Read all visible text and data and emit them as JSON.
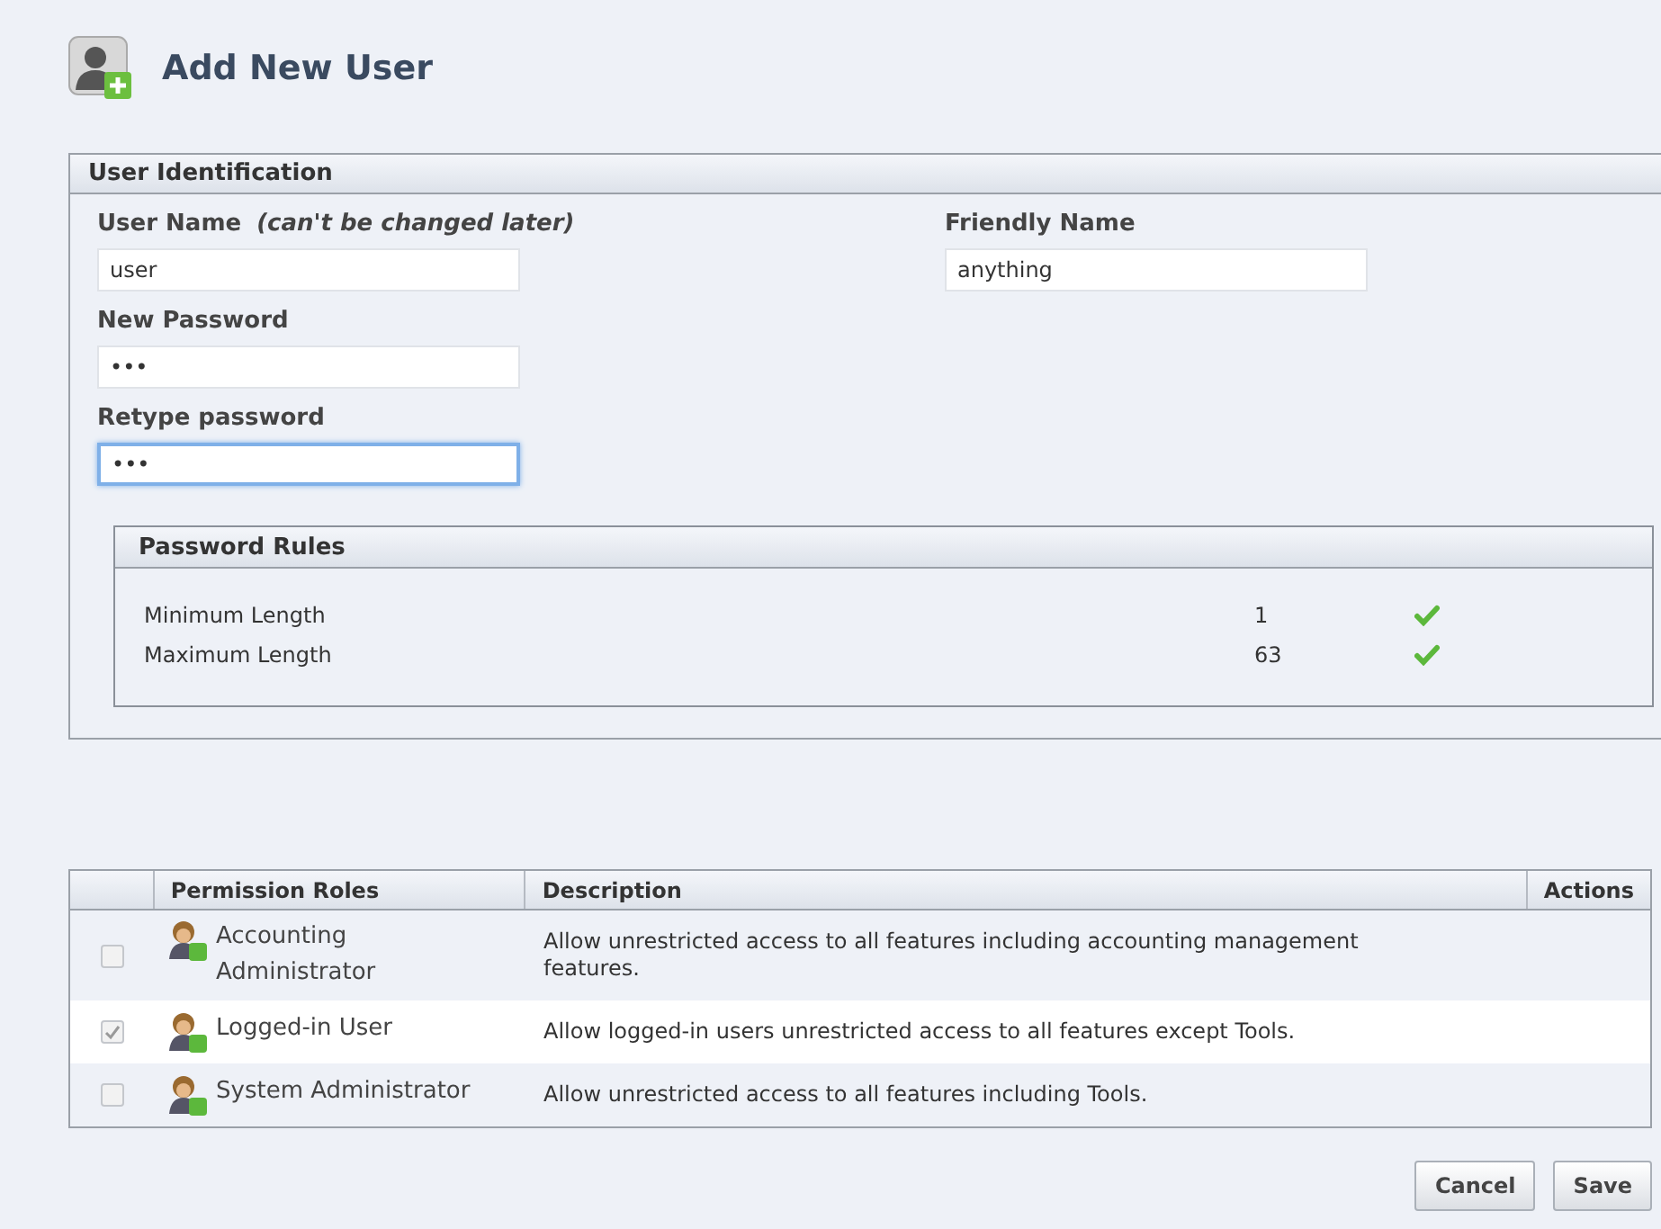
{
  "page": {
    "title": "Add New User"
  },
  "identification": {
    "title": "User Identification",
    "left_fields": [
      {
        "label": "User Name",
        "note": "(can't be changed later)",
        "value": "user",
        "focused": false
      },
      {
        "label": "New Password",
        "value": "•••",
        "focused": false
      },
      {
        "label": "Retype password",
        "value": "•••",
        "focused": true
      }
    ],
    "right_fields": [
      {
        "label": "Friendly Name",
        "value": "anything",
        "focused": false
      }
    ],
    "password_rules": {
      "title": "Password Rules",
      "rules": [
        {
          "name": "Minimum Length",
          "value": "1",
          "passed": true
        },
        {
          "name": "Maximum Length",
          "value": "63",
          "passed": true
        }
      ]
    }
  },
  "roles_table": {
    "columns": [
      "Permission Roles",
      "Description",
      "Actions"
    ],
    "rows": [
      {
        "role": "Accounting Administrator",
        "description": "Allow unrestricted access to all features including accounting management features.",
        "checked": false
      },
      {
        "role": "Logged-in User",
        "description": "Allow logged-in users unrestricted access to all features except Tools.",
        "checked": true
      },
      {
        "role": "System Administrator",
        "description": "Allow unrestricted access to all features including Tools.",
        "checked": false
      }
    ]
  },
  "buttons": [
    "Cancel",
    "Save"
  ]
}
